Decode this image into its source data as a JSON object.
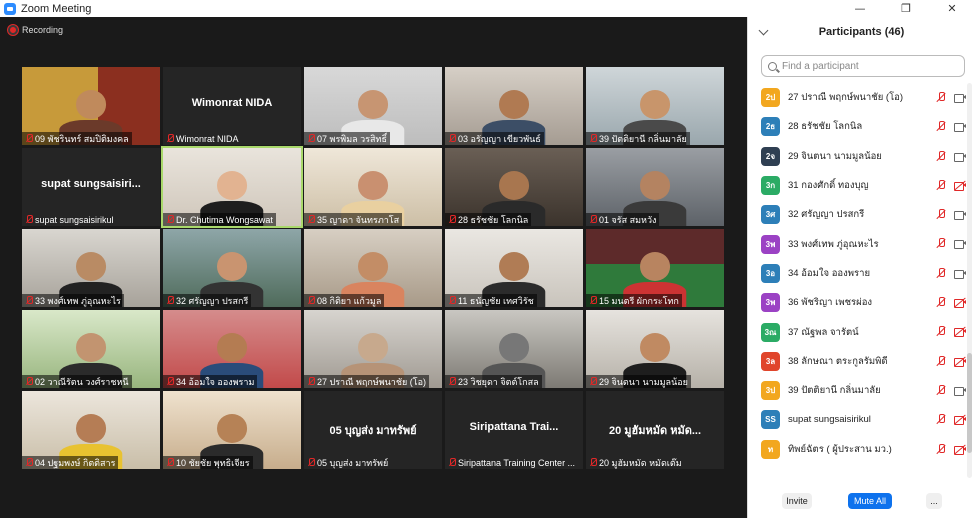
{
  "window": {
    "title": "Zoom Meeting",
    "controls": [
      "—",
      "❐",
      "✕"
    ]
  },
  "recording": {
    "label": "Recording"
  },
  "tiles": [
    {
      "label": "09 พัชรินทร์ สมปิติมงคล",
      "scene": "office"
    },
    {
      "label": "Wimonrat NIDA",
      "display": "Wimonrat NIDA"
    },
    {
      "label": "07 พรพิมล วรสิทธิ์",
      "scene": "mask-glasses"
    },
    {
      "label": "03 อรัญญา เขียวพันธ์",
      "scene": "man-room"
    },
    {
      "label": "39 ปัตติยานี กลิ่นมาลัย",
      "scene": "hijab"
    },
    {
      "label": "supat sungsaisirikul",
      "display": "supat sungsaisiri..."
    },
    {
      "label": "Dr. Chutima Wongsawat",
      "scene": "host",
      "active": true
    },
    {
      "label": "35 ญาดา จันทรภาโส",
      "scene": "smile"
    },
    {
      "label": "28 ธรัชชัย โลกนิล",
      "scene": "dark-room"
    },
    {
      "label": "01 จรัส สมหวัง",
      "scene": "glasses-man"
    },
    {
      "label": "33 พงศ์เทพ ภู่อุณหะไร",
      "scene": "youth"
    },
    {
      "label": "32 ศรัญญา ปรสกรี",
      "scene": "building"
    },
    {
      "label": "08 กิติยา แก้วมูล",
      "scene": "mask-woman"
    },
    {
      "label": "11 ธนัญชัย เทศวิรัช",
      "scene": "man-white"
    },
    {
      "label": "15 มนตรี ผักกระโทก",
      "scene": "stadium"
    },
    {
      "label": "02 วาณีรัตน วงศ์ราชหนี",
      "scene": "green-room"
    },
    {
      "label": "34 อ้อมใจ อองพราม",
      "scene": "woman-bed"
    },
    {
      "label": "27 ปราณี พฤกษ์พนาชัย (โอ)",
      "scene": "bear"
    },
    {
      "label": "23 วิชยุดา จิตต์โกสล",
      "scene": "train"
    },
    {
      "label": "29 จินตนา นามมูลน้อย",
      "scene": "woman-dark"
    },
    {
      "label": "04 ปฐมพงษ์ กิตติสาร",
      "scene": "mask-man"
    },
    {
      "label": "10 ชัยชัย พุทธิเจียร",
      "scene": "young-man"
    },
    {
      "label": "05 บุญส่ง มาทรัพย์",
      "display": "05 บุญส่ง มาทรัพย์"
    },
    {
      "label": "Siripattana Training Center ...",
      "display": "Siripattana Trai..."
    },
    {
      "label": "20 มูฮัมหมัด หมัดเต๊ม",
      "display": "20 มูฮัมหมัด หมัด..."
    }
  ],
  "panel": {
    "title": "Participants (46)",
    "search_placeholder": "Find a participant",
    "participants": [
      {
        "avatar": "2ป",
        "color": "#f2a71f",
        "name": "27 ปราณี พฤกษ์พนาชัย (โอ)",
        "cam_off": false
      },
      {
        "avatar": "2ธ",
        "color": "#2d7fb8",
        "name": "28 ธรัชชัย โลกนิล",
        "cam_off": false
      },
      {
        "avatar": "2จ",
        "color": "#2f3f52",
        "name": "29 จินตนา นามมูลน้อย",
        "cam_off": false
      },
      {
        "avatar": "3ก",
        "color": "#2bab65",
        "name": "31 กองศักดิ์ ทองบุญ",
        "cam_off": true
      },
      {
        "avatar": "3ศ",
        "color": "#2d7fb8",
        "name": "32 ศรัญญา ปรสกรี",
        "cam_off": false
      },
      {
        "avatar": "3พ",
        "color": "#9b42c4",
        "name": "33 พงศ์เทพ ภู่อุณหะไร",
        "cam_off": false
      },
      {
        "avatar": "3อ",
        "color": "#2d7fb8",
        "name": "34 อ้อมใจ อองพราย",
        "cam_off": false
      },
      {
        "avatar": "3พ",
        "color": "#9b42c4",
        "name": "36 พัชริญา เพชรผ่อง",
        "cam_off": true
      },
      {
        "avatar": "3ณ",
        "color": "#2bab65",
        "name": "37 ณัฐพล จารัตน์",
        "cam_off": true
      },
      {
        "avatar": "3ล",
        "color": "#e0452b",
        "name": "38 ลักษณา ตระกูลรัมพิดี",
        "cam_off": true
      },
      {
        "avatar": "3ป",
        "color": "#f2a71f",
        "name": "39 ปัตติยานี กลิ่นมาลัย",
        "cam_off": false
      },
      {
        "avatar": "SS",
        "color": "#2d7fb8",
        "name": "supat sungsaisirikul",
        "cam_off": true
      },
      {
        "avatar": "ท",
        "color": "#f2a71f",
        "name": "ทิพย์ฉัตร ( ผู้ประสาน มว.)",
        "cam_off": true
      }
    ],
    "invite_label": "Invite",
    "mute_all_label": "Mute All",
    "more_label": "..."
  }
}
